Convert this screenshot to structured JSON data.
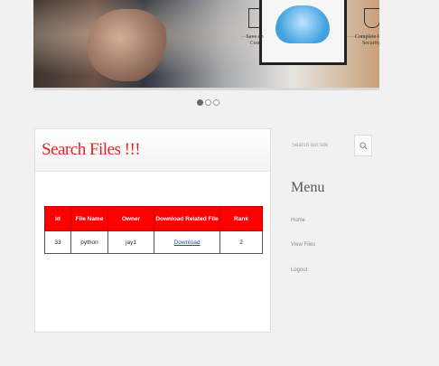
{
  "hero": {
    "caption_left": "Save on Cost",
    "caption_right": "Complete Data Security",
    "slides": 3,
    "active_slide": 1
  },
  "card": {
    "title": "Search Files !!!"
  },
  "table": {
    "headers": [
      "Id",
      "File Name",
      "Owner",
      "Download Related File",
      "Rank"
    ],
    "rows": [
      {
        "id": "33",
        "file_name": "python",
        "owner": "jay1",
        "download": "Download",
        "rank": "2"
      }
    ]
  },
  "sidebar": {
    "search_placeholder": "Search our site",
    "menu_title": "Menu",
    "items": [
      {
        "label": "Home"
      },
      {
        "label": "View Files"
      },
      {
        "label": "Logout"
      }
    ]
  },
  "colors": {
    "title_red": "#e6231f",
    "header_red": "#ff0000",
    "link_blue": "#1a4fa0"
  }
}
